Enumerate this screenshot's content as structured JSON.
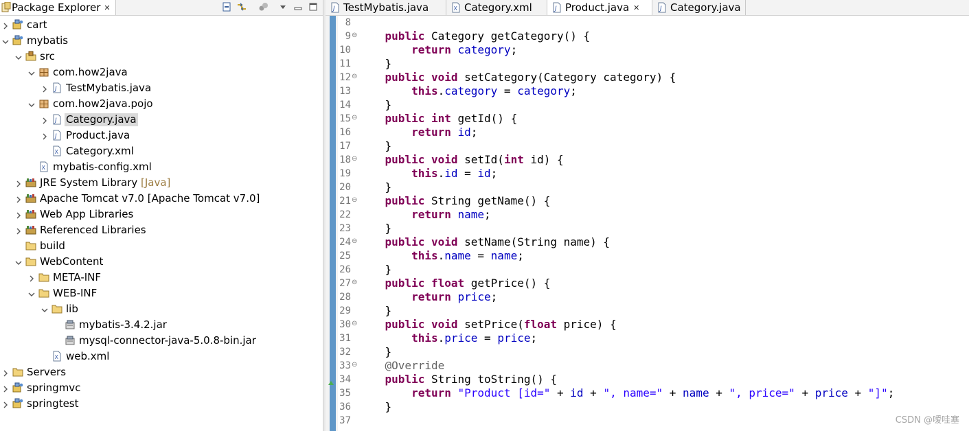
{
  "explorer": {
    "title": "Package Explorer",
    "tree": [
      {
        "label": "cart",
        "depth": 0,
        "icon": "project-icon",
        "expanded": false,
        "expandable": true
      },
      {
        "label": "mybatis",
        "depth": 0,
        "icon": "project-icon",
        "expanded": true,
        "expandable": true
      },
      {
        "label": "src",
        "depth": 1,
        "icon": "source-folder-icon",
        "expanded": true,
        "expandable": true
      },
      {
        "label": "com.how2java",
        "depth": 2,
        "icon": "package-icon",
        "expanded": true,
        "expandable": true
      },
      {
        "label": "TestMybatis.java",
        "depth": 3,
        "icon": "java-file-icon",
        "expanded": false,
        "expandable": true
      },
      {
        "label": "com.how2java.pojo",
        "depth": 2,
        "icon": "package-icon",
        "expanded": true,
        "expandable": true
      },
      {
        "label": "Category.java",
        "depth": 3,
        "icon": "java-file-icon",
        "expanded": false,
        "expandable": true,
        "selected": true
      },
      {
        "label": "Product.java",
        "depth": 3,
        "icon": "java-file-icon",
        "expanded": false,
        "expandable": true
      },
      {
        "label": "Category.xml",
        "depth": 3,
        "icon": "xml-file-icon",
        "expandable": false
      },
      {
        "label": "mybatis-config.xml",
        "depth": 2,
        "icon": "xml-file-icon",
        "expandable": false
      },
      {
        "label": "JRE System Library",
        "decoration": " [Java]",
        "depth": 1,
        "icon": "library-icon",
        "expanded": false,
        "expandable": true
      },
      {
        "label": "Apache Tomcat v7.0 [Apache Tomcat v7.0]",
        "depth": 1,
        "icon": "library-icon",
        "expanded": false,
        "expandable": true
      },
      {
        "label": "Web App Libraries",
        "depth": 1,
        "icon": "library-icon",
        "expanded": false,
        "expandable": true
      },
      {
        "label": "Referenced Libraries",
        "depth": 1,
        "icon": "library-icon",
        "expanded": false,
        "expandable": true
      },
      {
        "label": "build",
        "depth": 1,
        "icon": "folder-icon",
        "expandable": false
      },
      {
        "label": "WebContent",
        "depth": 1,
        "icon": "folder-icon",
        "expanded": true,
        "expandable": true
      },
      {
        "label": "META-INF",
        "depth": 2,
        "icon": "folder-icon",
        "expanded": false,
        "expandable": true
      },
      {
        "label": "WEB-INF",
        "depth": 2,
        "icon": "folder-icon",
        "expanded": true,
        "expandable": true
      },
      {
        "label": "lib",
        "depth": 3,
        "icon": "folder-icon",
        "expanded": true,
        "expandable": true
      },
      {
        "label": "mybatis-3.4.2.jar",
        "depth": 4,
        "icon": "jar-icon",
        "expandable": false
      },
      {
        "label": "mysql-connector-java-5.0.8-bin.jar",
        "depth": 4,
        "icon": "jar-icon",
        "expandable": false
      },
      {
        "label": "web.xml",
        "depth": 3,
        "icon": "xml-file-icon",
        "expandable": false
      },
      {
        "label": "Servers",
        "depth": 0,
        "icon": "folder-icon",
        "expanded": false,
        "expandable": true
      },
      {
        "label": "springmvc",
        "depth": 0,
        "icon": "project-icon",
        "expanded": false,
        "expandable": true
      },
      {
        "label": "springtest",
        "depth": 0,
        "icon": "project-icon",
        "expanded": false,
        "expandable": true
      }
    ]
  },
  "editor": {
    "tabs": [
      {
        "label": "TestMybatis.java",
        "icon": "java-file-icon",
        "active": false
      },
      {
        "label": "Category.xml",
        "icon": "xml-file-icon",
        "active": false
      },
      {
        "label": "Product.java",
        "icon": "java-file-icon",
        "active": true
      },
      {
        "label": "Category.java",
        "icon": "java-file-icon",
        "active": false
      }
    ],
    "lines": [
      {
        "n": "8",
        "text": "",
        "fold": ""
      },
      {
        "n": "9",
        "text": "    public Category getCategory() {",
        "fold": "⊖"
      },
      {
        "n": "10",
        "text": "        return category;",
        "fold": ""
      },
      {
        "n": "11",
        "text": "    }",
        "fold": ""
      },
      {
        "n": "12",
        "text": "    public void setCategory(Category category) {",
        "fold": "⊖"
      },
      {
        "n": "13",
        "text": "        this.category = category;",
        "fold": ""
      },
      {
        "n": "14",
        "text": "    }",
        "fold": ""
      },
      {
        "n": "15",
        "text": "    public int getId() {",
        "fold": "⊖"
      },
      {
        "n": "16",
        "text": "        return id;",
        "fold": ""
      },
      {
        "n": "17",
        "text": "    }",
        "fold": ""
      },
      {
        "n": "18",
        "text": "    public void setId(int id) {",
        "fold": "⊖"
      },
      {
        "n": "19",
        "text": "        this.id = id;",
        "fold": ""
      },
      {
        "n": "20",
        "text": "    }",
        "fold": ""
      },
      {
        "n": "21",
        "text": "    public String getName() {",
        "fold": "⊖"
      },
      {
        "n": "22",
        "text": "        return name;",
        "fold": ""
      },
      {
        "n": "23",
        "text": "    }",
        "fold": ""
      },
      {
        "n": "24",
        "text": "    public void setName(String name) {",
        "fold": "⊖"
      },
      {
        "n": "25",
        "text": "        this.name = name;",
        "fold": ""
      },
      {
        "n": "26",
        "text": "    }",
        "fold": ""
      },
      {
        "n": "27",
        "text": "    public float getPrice() {",
        "fold": "⊖"
      },
      {
        "n": "28",
        "text": "        return price;",
        "fold": ""
      },
      {
        "n": "29",
        "text": "    }",
        "fold": ""
      },
      {
        "n": "30",
        "text": "    public void setPrice(float price) {",
        "fold": "⊖"
      },
      {
        "n": "31",
        "text": "        this.price = price;",
        "fold": ""
      },
      {
        "n": "32",
        "text": "    }",
        "fold": ""
      },
      {
        "n": "33",
        "text": "    @Override",
        "fold": "⊖"
      },
      {
        "n": "34",
        "text": "    public String toString() {",
        "fold": "",
        "override_marker": true
      },
      {
        "n": "35",
        "text": "        return \"Product [id=\" + id + \", name=\" + name + \", price=\" + price + \"]\";",
        "fold": ""
      },
      {
        "n": "36",
        "text": "    }",
        "fold": ""
      },
      {
        "n": "37",
        "text": "",
        "fold": ""
      }
    ]
  },
  "watermark": "CSDN @嗳哇塞",
  "colors": {
    "keyword": "#7f0055",
    "field": "#0000c0",
    "string": "#2a00ff",
    "annotation": "#646464",
    "ruler": "#5f97c8"
  }
}
